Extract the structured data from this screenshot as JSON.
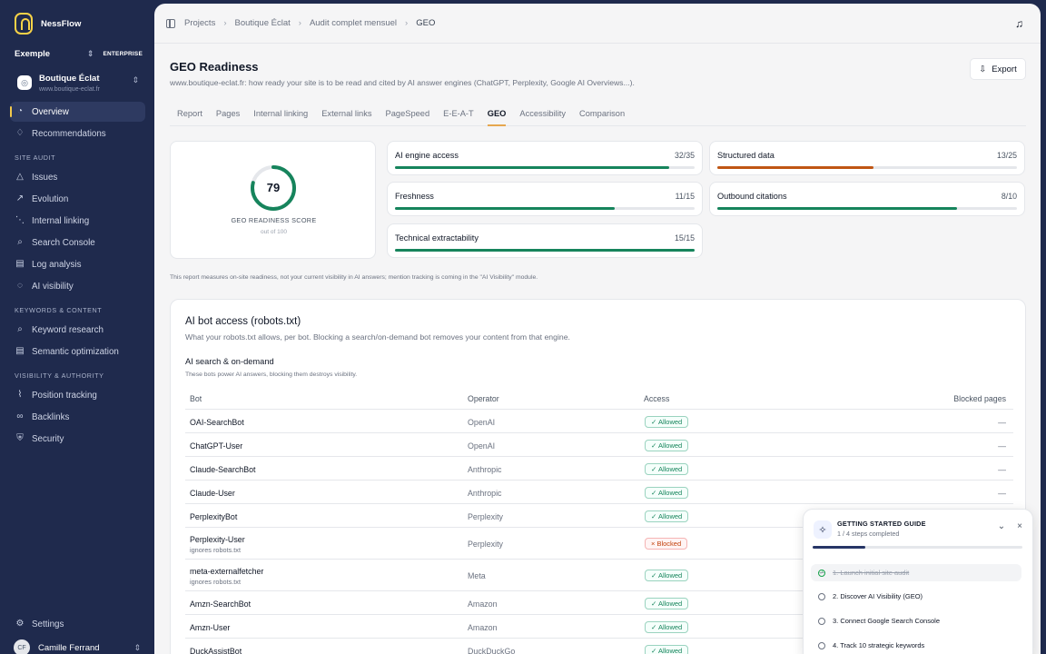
{
  "brand": {
    "name": "NessFlow"
  },
  "workspace": {
    "name": "Exemple",
    "plan": "ENTERPRISE"
  },
  "site": {
    "name": "Boutique Éclat",
    "url": "www.boutique-eclat.fr"
  },
  "nav": {
    "overview": "Overview",
    "recommendations": "Recommendations",
    "site_audit": "SITE AUDIT",
    "issues": "Issues",
    "evolution": "Evolution",
    "internal_linking": "Internal linking",
    "search_console": "Search Console",
    "log_analysis": "Log analysis",
    "ai_visibility": "AI visibility",
    "keywords_content": "KEYWORDS & CONTENT",
    "keyword_research": "Keyword research",
    "semantic_optimization": "Semantic optimization",
    "visibility_authority": "VISIBILITY & AUTHORITY",
    "position_tracking": "Position tracking",
    "backlinks": "Backlinks",
    "security": "Security",
    "settings": "Settings"
  },
  "user": {
    "initials": "CF",
    "name": "Camille Ferrand"
  },
  "breadcrumb": [
    "Projects",
    "Boutique Éclat",
    "Audit complet mensuel",
    "GEO"
  ],
  "page": {
    "title": "GEO Readiness",
    "subtitle": "www.boutique-eclat.fr: how ready your site is to be read and cited by AI answer engines (ChatGPT, Perplexity, Google AI Overviews...).",
    "export_label": "Export"
  },
  "tabs": [
    "Report",
    "Pages",
    "Internal linking",
    "External links",
    "PageSpeed",
    "E-E-A-T",
    "GEO",
    "Accessibility",
    "Comparison"
  ],
  "score": {
    "value": 79,
    "label": "GEO READINESS SCORE",
    "out_of": "out of 100"
  },
  "metrics": [
    {
      "name": "AI engine access",
      "score": "32/35",
      "fraction": 0.914,
      "color": "#16845c"
    },
    {
      "name": "Structured data",
      "score": "13/25",
      "fraction": 0.52,
      "color": "#c05614"
    },
    {
      "name": "Freshness",
      "score": "11/15",
      "fraction": 0.733,
      "color": "#16845c"
    },
    {
      "name": "Outbound citations",
      "score": "8/10",
      "fraction": 0.8,
      "color": "#16845c"
    },
    {
      "name": "Technical extractability",
      "score": "15/15",
      "fraction": 1.0,
      "color": "#16845c"
    }
  ],
  "note": "This report measures on-site readiness, not your current visibility in AI answers; mention tracking is coming in the \"AI Visibility\" module.",
  "access": {
    "title": "AI bot access (robots.txt)",
    "description": "What your robots.txt allows, per bot. Blocking a search/on-demand bot removes your content from that engine.",
    "group_title": "AI search & on-demand",
    "group_description": "These bots power AI answers, blocking them destroys visibility.",
    "columns": {
      "bot": "Bot",
      "operator": "Operator",
      "access": "Access",
      "blocked_pages": "Blocked pages"
    },
    "rows": [
      {
        "bot": "OAI-SearchBot",
        "operator": "OpenAI",
        "status": "Allowed",
        "blocked": "—"
      },
      {
        "bot": "ChatGPT-User",
        "operator": "OpenAI",
        "status": "Allowed",
        "blocked": "—"
      },
      {
        "bot": "Claude-SearchBot",
        "operator": "Anthropic",
        "status": "Allowed",
        "blocked": "—"
      },
      {
        "bot": "Claude-User",
        "operator": "Anthropic",
        "status": "Allowed",
        "blocked": "—"
      },
      {
        "bot": "PerplexityBot",
        "operator": "Perplexity",
        "status": "Allowed",
        "blocked": ""
      },
      {
        "bot": "Perplexity-User",
        "note": "ignores robots.txt",
        "operator": "Perplexity",
        "status": "Blocked",
        "blocked": ""
      },
      {
        "bot": "meta-externalfetcher",
        "note": "ignores robots.txt",
        "operator": "Meta",
        "status": "Allowed",
        "blocked": ""
      },
      {
        "bot": "Amzn-SearchBot",
        "operator": "Amazon",
        "status": "Allowed",
        "blocked": ""
      },
      {
        "bot": "Amzn-User",
        "operator": "Amazon",
        "status": "Allowed",
        "blocked": ""
      },
      {
        "bot": "DuckAssistBot",
        "operator": "DuckDuckGo",
        "status": "Allowed",
        "blocked": ""
      }
    ]
  },
  "guide": {
    "title": "GETTING STARTED GUIDE",
    "progress": "1 / 4 steps completed",
    "progress_fraction": 0.25,
    "steps": [
      "1. Launch initial site audit",
      "2. Discover AI Visibility (GEO)",
      "3. Connect Google Search Console",
      "4. Track 10 strategic keywords"
    ]
  }
}
